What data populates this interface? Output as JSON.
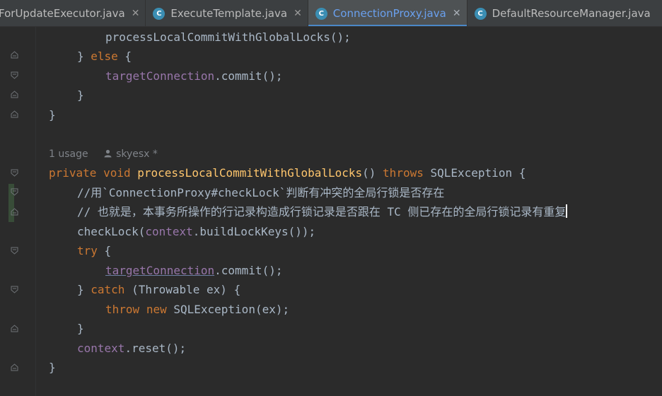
{
  "tabs": [
    {
      "label": "ForUpdateExecutor.java",
      "icon": "",
      "close": "✕",
      "active": false
    },
    {
      "label": "ExecuteTemplate.java",
      "icon": "C",
      "close": "✕",
      "active": false
    },
    {
      "label": "ConnectionProxy.java",
      "icon": "C",
      "close": "✕",
      "active": true
    },
    {
      "label": "DefaultResourceManager.java",
      "icon": "C",
      "close": "",
      "active": false
    }
  ],
  "hint": {
    "usage": "1 usage",
    "author": "skyesx *"
  },
  "tokens": {
    "processLocalCommitWithGlobalLocks": "processLocalCommitWithGlobalLocks",
    "call_suffix": "();",
    "close_brace": "}",
    "else_open_prefix": "} ",
    "else_kw": "else",
    "open_brace": " {",
    "targetConnection": "targetConnection",
    "dot_commit": ".commit",
    "private_kw": "private",
    "void_kw": "void",
    "sig_parens": "()",
    "throws_kw": "throws",
    "SQLException": "SQLException",
    "comment1": "//用`ConnectionProxy#checkLock`判断有冲突的全局行锁是否存在",
    "comment2": "// 也就是，本事务所操作的行记录构造成行锁记录是否跟在 TC 侧已存在的全局行锁记录有重复",
    "checkLock_open": "checkLock(",
    "context": "context",
    "buildLockKeys": ".buildLockKeys());",
    "try_kw": "try",
    "catch_kw": "catch",
    "catch_args": " (Throwable ex) {",
    "throw_kw": "throw",
    "new_kw": "new",
    "new_exc": " SQLException(ex);",
    "reset_call": ".reset();"
  }
}
